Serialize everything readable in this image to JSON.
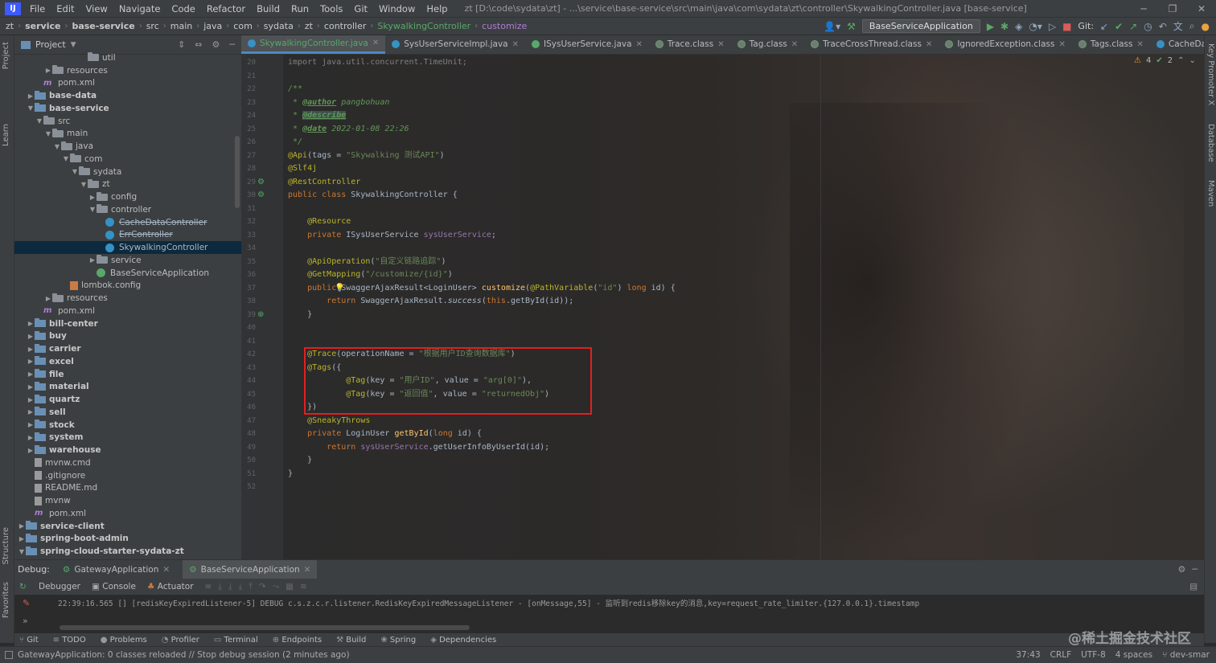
{
  "menubar": {
    "items": [
      "File",
      "Edit",
      "View",
      "Navigate",
      "Code",
      "Refactor",
      "Build",
      "Run",
      "Tools",
      "Git",
      "Window",
      "Help"
    ],
    "title": "zt [D:\\code\\sydata\\zt] - ...\\service\\base-service\\src\\main\\java\\com\\sydata\\zt\\controller\\SkywalkingController.java [base-service]"
  },
  "navbar": {
    "crumbs": [
      "zt",
      "service",
      "base-service",
      "src",
      "main",
      "java",
      "com",
      "sydata",
      "zt",
      "controller",
      "SkywalkingController",
      "customize"
    ],
    "run_config": "BaseServiceApplication",
    "git_label": "Git:"
  },
  "project": {
    "title": "Project",
    "rows": [
      {
        "label": "util",
        "depth": 7,
        "icon": "folder",
        "arrow": ""
      },
      {
        "label": "resources",
        "depth": 3,
        "icon": "folder",
        "arrow": "▶"
      },
      {
        "label": "pom.xml",
        "depth": 2,
        "icon": "xml",
        "arrow": ""
      },
      {
        "label": "base-data",
        "depth": 1,
        "icon": "mod",
        "arrow": "▶",
        "bold": true
      },
      {
        "label": "base-service",
        "depth": 1,
        "icon": "mod",
        "arrow": "▼",
        "bold": true
      },
      {
        "label": "src",
        "depth": 2,
        "icon": "folder",
        "arrow": "▼"
      },
      {
        "label": "main",
        "depth": 3,
        "icon": "folder",
        "arrow": "▼"
      },
      {
        "label": "java",
        "depth": 4,
        "icon": "folder",
        "arrow": "▼"
      },
      {
        "label": "com",
        "depth": 5,
        "icon": "folder",
        "arrow": "▼"
      },
      {
        "label": "sydata",
        "depth": 6,
        "icon": "folder",
        "arrow": "▼"
      },
      {
        "label": "zt",
        "depth": 7,
        "icon": "folder",
        "arrow": "▼"
      },
      {
        "label": "config",
        "depth": 8,
        "icon": "folder",
        "arrow": "▶"
      },
      {
        "label": "controller",
        "depth": 8,
        "icon": "folder",
        "arrow": "▼"
      },
      {
        "label": "CacheDataController",
        "depth": 9,
        "icon": "cls",
        "arrow": "",
        "strike": true
      },
      {
        "label": "ErrController",
        "depth": 9,
        "icon": "cls",
        "arrow": "",
        "strike": true
      },
      {
        "label": "SkywalkingController",
        "depth": 9,
        "icon": "cls",
        "arrow": "",
        "selected": true
      },
      {
        "label": "service",
        "depth": 8,
        "icon": "folder",
        "arrow": "▶"
      },
      {
        "label": "BaseServiceApplication",
        "depth": 8,
        "icon": "app",
        "arrow": ""
      },
      {
        "label": "lombok.config",
        "depth": 5,
        "icon": "cfg",
        "arrow": ""
      },
      {
        "label": "resources",
        "depth": 3,
        "icon": "folder",
        "arrow": "▶"
      },
      {
        "label": "pom.xml",
        "depth": 2,
        "icon": "xml",
        "arrow": ""
      },
      {
        "label": "bill-center",
        "depth": 1,
        "icon": "mod",
        "arrow": "▶",
        "bold": true
      },
      {
        "label": "buy",
        "depth": 1,
        "icon": "mod",
        "arrow": "▶",
        "bold": true
      },
      {
        "label": "carrier",
        "depth": 1,
        "icon": "mod",
        "arrow": "▶",
        "bold": true
      },
      {
        "label": "excel",
        "depth": 1,
        "icon": "mod",
        "arrow": "▶",
        "bold": true
      },
      {
        "label": "file",
        "depth": 1,
        "icon": "mod",
        "arrow": "▶",
        "bold": true
      },
      {
        "label": "material",
        "depth": 1,
        "icon": "mod",
        "arrow": "▶",
        "bold": true
      },
      {
        "label": "quartz",
        "depth": 1,
        "icon": "mod",
        "arrow": "▶",
        "bold": true
      },
      {
        "label": "sell",
        "depth": 1,
        "icon": "mod",
        "arrow": "▶",
        "bold": true
      },
      {
        "label": "stock",
        "depth": 1,
        "icon": "mod",
        "arrow": "▶",
        "bold": true
      },
      {
        "label": "system",
        "depth": 1,
        "icon": "mod",
        "arrow": "▶",
        "bold": true
      },
      {
        "label": "warehouse",
        "depth": 1,
        "icon": "mod",
        "arrow": "▶",
        "bold": true
      },
      {
        "label": "mvnw.cmd",
        "depth": 1,
        "icon": "file",
        "arrow": ""
      },
      {
        "label": ".gitignore",
        "depth": 1,
        "icon": "file",
        "arrow": ""
      },
      {
        "label": "README.md",
        "depth": 1,
        "icon": "file",
        "arrow": ""
      },
      {
        "label": "mvnw",
        "depth": 1,
        "icon": "file",
        "arrow": ""
      },
      {
        "label": "pom.xml",
        "depth": 1,
        "icon": "xml",
        "arrow": ""
      },
      {
        "label": "service-client",
        "depth": 0,
        "icon": "mod",
        "arrow": "▶",
        "bold": true
      },
      {
        "label": "spring-boot-admin",
        "depth": 0,
        "icon": "mod",
        "arrow": "▶",
        "bold": true
      },
      {
        "label": "spring-cloud-starter-sydata-zt",
        "depth": 0,
        "icon": "mod",
        "arrow": "▼",
        "bold": true
      }
    ]
  },
  "tabs": [
    {
      "label": "SkywalkingController.java",
      "kind": "class",
      "active": true
    },
    {
      "label": "SysUserServiceImpl.java",
      "kind": "class"
    },
    {
      "label": "ISysUserService.java",
      "kind": "interface"
    },
    {
      "label": "Trace.class",
      "kind": "compiled"
    },
    {
      "label": "Tag.class",
      "kind": "compiled"
    },
    {
      "label": "TraceCrossThread.class",
      "kind": "compiled"
    },
    {
      "label": "IgnoredException.class",
      "kind": "compiled"
    },
    {
      "label": "Tags.class",
      "kind": "compiled"
    },
    {
      "label": "CacheDataController.java",
      "kind": "class"
    }
  ],
  "inspections": {
    "warnings": "4",
    "ok": "2"
  },
  "code": [
    {
      "n": "20",
      "html": "<span class='grey'>import java.util.concurrent.TimeUnit;</span>"
    },
    {
      "n": "21",
      "html": ""
    },
    {
      "n": "22",
      "html": "<span class='cmt'>/**</span>"
    },
    {
      "n": "23",
      "html": "<span class='cmt'> * </span><span class='tag'>@author</span><span class='cmt'> pangbohuan</span>"
    },
    {
      "n": "24",
      "html": "<span class='cmt'> * </span><span class='tag' style='background:#3b514d'>@describe</span>"
    },
    {
      "n": "25",
      "html": "<span class='cmt'> * </span><span class='tag'>@date</span><span class='cmt'> 2022-01-08 22:26</span>"
    },
    {
      "n": "26",
      "html": "<span class='cmt'> */</span>"
    },
    {
      "n": "27",
      "html": "<span class='ann'>@Api</span>(tags = <span class='str'>\"Skywalking 测试API\"</span>)"
    },
    {
      "n": "28",
      "html": "<span class='ann'>@Slf4j</span>"
    },
    {
      "n": "29",
      "html": "<span class='ann'>@RestController</span>"
    },
    {
      "n": "30",
      "html": "<span class='kw'>public class</span> SkywalkingController {"
    },
    {
      "n": "31",
      "html": ""
    },
    {
      "n": "32",
      "html": "    <span class='ann'>@Resource</span>"
    },
    {
      "n": "33",
      "html": "    <span class='kw'>private</span> ISysUserService <span class='fld'>sysUserService</span>;"
    },
    {
      "n": "34",
      "html": ""
    },
    {
      "n": "35",
      "html": "    <span class='ann'>@ApiOperation</span>(<span class='str'>\"自定义链路追踪\"</span>)"
    },
    {
      "n": "36",
      "html": "    <span class='ann'>@GetMapping</span>(<span class='str'>\"/customize/{id}\"</span>)"
    },
    {
      "n": "37",
      "html": "    <span class='kw'>public</span> SwaggerAjaxResult&lt;LoginUser&gt; <span class='fn'>customize</span>(<span class='ann'>@PathVariable</span>(<span class='str'>\"id\"</span>) <span class='kw'>long</span> id) {"
    },
    {
      "n": "38",
      "html": "        <span class='kw'>return</span> SwaggerAjaxResult.<i>success</i>(<span class='kw'>this</span>.getById(id));"
    },
    {
      "n": "39",
      "html": "    }"
    },
    {
      "n": "40",
      "html": ""
    },
    {
      "n": "41",
      "html": ""
    },
    {
      "n": "42",
      "html": "    <span class='ann'>@Trace</span>(operationName = <span class='str'>\"根据用户ID查询数据库\"</span>)"
    },
    {
      "n": "43",
      "html": "    <span class='ann'>@Tags</span>({"
    },
    {
      "n": "44",
      "html": "            <span class='ann'>@Tag</span>(key = <span class='str'>\"用户ID\"</span>, value = <span class='str'>\"arg[0]\"</span>),"
    },
    {
      "n": "45",
      "html": "            <span class='ann'>@Tag</span>(key = <span class='str'>\"返回值\"</span>, value = <span class='str'>\"returnedObj\"</span>)"
    },
    {
      "n": "46",
      "html": "    })"
    },
    {
      "n": "47",
      "html": "    <span class='ann'>@SneakyThrows</span>"
    },
    {
      "n": "48",
      "html": "    <span class='kw'>private</span> LoginUser <span class='fn'>getById</span>(<span class='kw'>long</span> id) {"
    },
    {
      "n": "49",
      "html": "        <span class='kw'>return</span> <span class='fld'>sysUserService</span>.getUserInfoByUserId(id);"
    },
    {
      "n": "50",
      "html": "    }"
    },
    {
      "n": "51",
      "html": "}"
    },
    {
      "n": "52",
      "html": ""
    }
  ],
  "debug": {
    "label": "Debug:",
    "tabs": [
      "GatewayApplication",
      "BaseServiceApplication"
    ],
    "tools": [
      "Debugger",
      "Console",
      "Actuator"
    ],
    "console_line": "22:39:16.565 [] [redisKeyExpiredListener-5] DEBUG c.s.z.c.r.listener.RedisKeyExpiredMessageListener - [onMessage,55] - 监听到redis移除key的消息,key=request_rate_limiter.{127.0.0.1}.timestamp"
  },
  "bottom_tabs": [
    "Git",
    "TODO",
    "Problems",
    "Profiler",
    "Terminal",
    "Endpoints",
    "Build",
    "Spring",
    "Dependencies"
  ],
  "status": {
    "message": "GatewayApplication: 0 classes reloaded // Stop debug session (2 minutes ago)",
    "position": "37:43",
    "line_sep": "CRLF",
    "encoding": "UTF-8",
    "indent": "4 spaces",
    "branch": "dev-smar"
  },
  "side_labels": {
    "left": [
      "Project",
      "Learn",
      "Structure",
      "Favorites"
    ],
    "right": [
      "Key Promoter X",
      "Database",
      "Maven"
    ]
  },
  "watermark": "@稀土掘金技术社区"
}
